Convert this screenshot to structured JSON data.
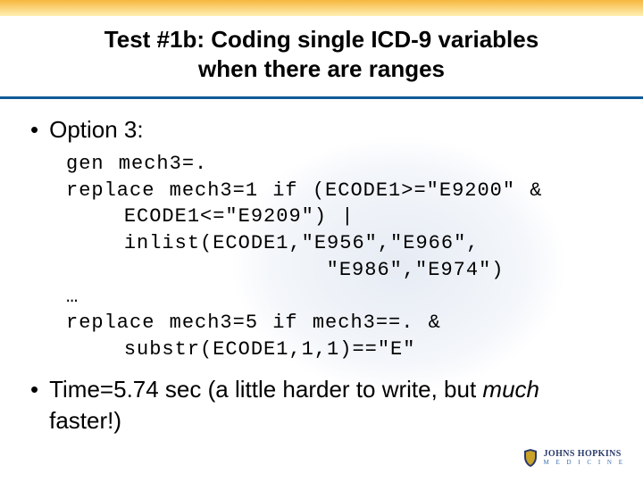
{
  "title_line1": "Test #1b: Coding single ICD-9 variables",
  "title_line2": "when there are ranges",
  "bullet1": "Option 3:",
  "code_block": "gen mech3=.\nreplace mech3=1 if (ECODE1>=\"E9200\" &\n    ECODE1<=\"E9209\") |\n    inlist(ECODE1,\"E956\",\"E966\",\n                  \"E986\",\"E974\")\n…\nreplace mech3=5 if mech3==. &\n    substr(ECODE1,1,1)==\"E\"",
  "bullet2_prefix": "Time=5.74 sec (a little harder to write, but ",
  "bullet2_em": "much",
  "bullet2_suffix": " faster!)",
  "logo": {
    "line1": "JOHNS HOPKINS",
    "line2": "M E D I C I N E"
  }
}
